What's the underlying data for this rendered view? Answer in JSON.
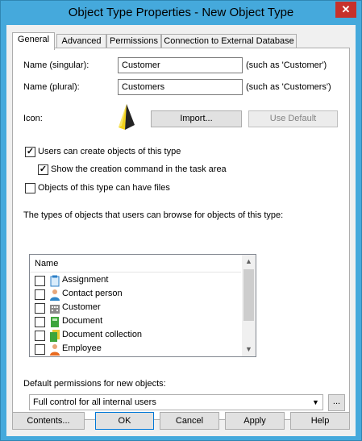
{
  "window": {
    "title": "Object Type Properties - New Object Type",
    "close_glyph": "✕"
  },
  "tabs": [
    "General",
    "Advanced",
    "Permissions",
    "Connection to External Database"
  ],
  "form": {
    "name_singular_label": "Name (singular):",
    "name_singular_value": "Customer",
    "name_singular_hint": "(such as 'Customer')",
    "name_plural_label": "Name (plural):",
    "name_plural_value": "Customers",
    "name_plural_hint": "(such as 'Customers')",
    "icon_label": "Icon:",
    "import_button": "Import...",
    "use_default_button": "Use Default",
    "users_can_create_label": "Users can create objects of this type",
    "users_can_create_checked": true,
    "show_creation_label": "Show the creation command in the task area",
    "show_creation_checked": true,
    "have_files_label": "Objects of this type can have files",
    "have_files_checked": false,
    "browse_types_label": "The types of objects that users can browse for objects of this type:",
    "list_header": "Name",
    "list_items": [
      {
        "label": "Assignment",
        "icon": "assignment-icon",
        "checked": false
      },
      {
        "label": "Contact person",
        "icon": "contact-person-icon",
        "checked": false
      },
      {
        "label": "Customer",
        "icon": "customer-icon",
        "checked": false
      },
      {
        "label": "Document",
        "icon": "document-icon",
        "checked": false
      },
      {
        "label": "Document collection",
        "icon": "document-collection-icon",
        "checked": false
      },
      {
        "label": "Employee",
        "icon": "employee-icon",
        "checked": false
      }
    ],
    "default_permissions_label": "Default permissions for new objects:",
    "default_permissions_value": "Full control for all internal users",
    "permissions_ellipsis": "..."
  },
  "buttons": {
    "contents": "Contents...",
    "ok": "OK",
    "cancel": "Cancel",
    "apply": "Apply",
    "help": "Help"
  },
  "colors": {
    "titlebar": "#45a9dc",
    "close": "#c7312b",
    "accent": "#0078d7"
  }
}
